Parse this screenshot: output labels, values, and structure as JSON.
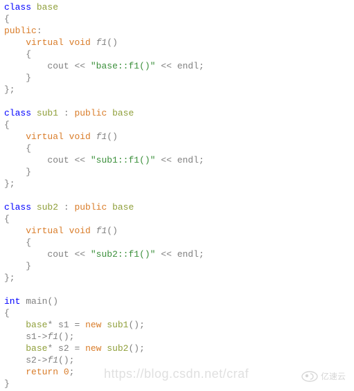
{
  "code": {
    "kw": {
      "class": "class",
      "public_lbl": "public",
      "public": "public",
      "virtual": "virtual",
      "void": "void",
      "int": "int",
      "new": "new",
      "return": "return"
    },
    "types": {
      "base": "base",
      "sub1": "sub1",
      "sub2": "sub2"
    },
    "fn": {
      "f1": "f1",
      "main": "main"
    },
    "vars": {
      "s1": "s1",
      "s2": "s2"
    },
    "strings": {
      "base_f1": "\"base::f1()\"",
      "sub1_f1": "\"sub1::f1()\"",
      "sub2_f1": "\"sub2::f1()\""
    },
    "ids": {
      "cout": "cout",
      "endl": "endl"
    },
    "num": {
      "zero": "0"
    }
  },
  "watermark": {
    "url": "https://blog.csdn.net/craf",
    "logo_text": "亿速云"
  }
}
